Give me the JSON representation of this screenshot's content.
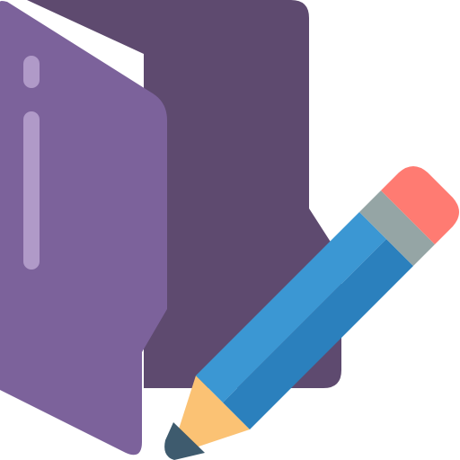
{
  "icon": {
    "semantic_name": "edit-folder-icon",
    "parts": {
      "folder": "folder-icon",
      "pencil": "pencil-icon"
    },
    "colors": {
      "folder_back": "#5e4a6f",
      "folder_front": "#7c629b",
      "folder_highlight": "#b09ac8",
      "pencil_body_light": "#3b97d3",
      "pencil_body_dark": "#2b80bd",
      "pencil_ferrule": "#95a5a5",
      "pencil_eraser": "#ff7b72",
      "pencil_wood": "#fbc274",
      "pencil_lead": "#3e5b6e"
    }
  }
}
